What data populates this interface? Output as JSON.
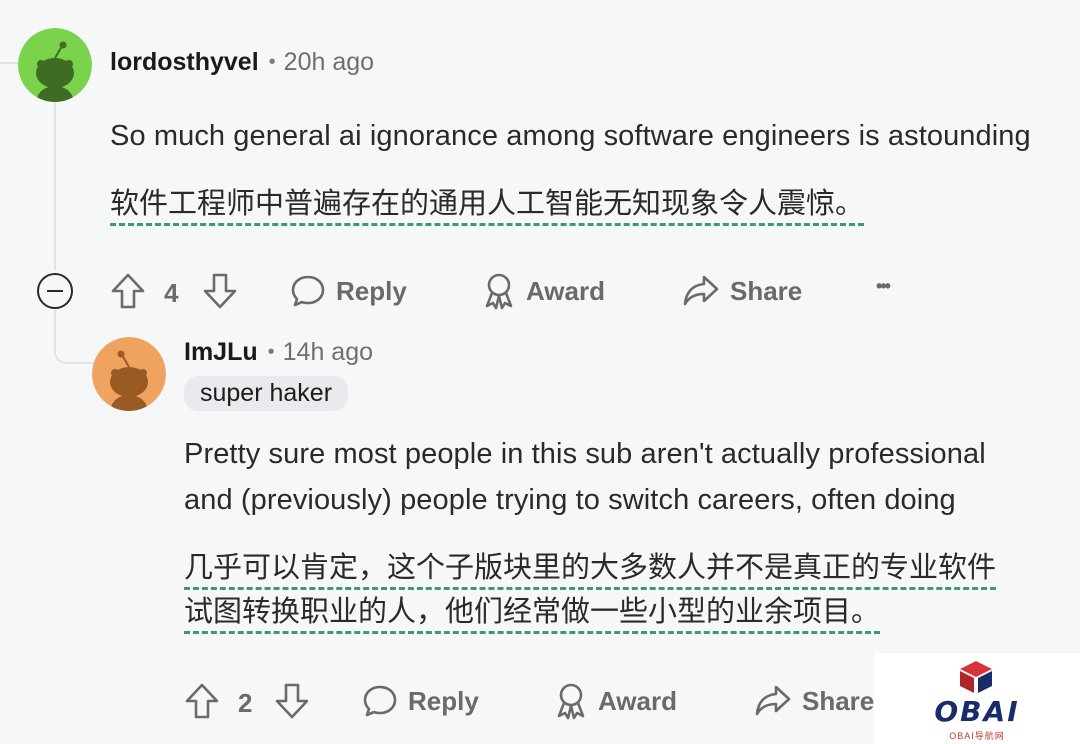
{
  "comment1": {
    "username": "lordosthyvel",
    "separator": "•",
    "time": "20h ago",
    "text_en": "So much general ai ignorance among software engineers is astounding",
    "text_cn": "软件工程师中普遍存在的通用人工智能无知现象令人震惊。",
    "votes": "4",
    "reply_label": "Reply",
    "award_label": "Award",
    "share_label": "Share",
    "more_label": "•••",
    "avatar_color": "#7bd34b"
  },
  "comment2": {
    "username": "ImJLu",
    "separator": "•",
    "time": "14h ago",
    "flair": "super haker",
    "text_en_line1": "Pretty sure most people in this sub aren't actually professional",
    "text_en_line2": "and (previously) people trying to switch careers, often doing",
    "text_cn_line1": "几乎可以肯定，这个子版块里的大多数人并不是真正的专业软件",
    "text_cn_line2": "试图转换职业的人，他们经常做一些小型的业余项目。",
    "votes": "2",
    "reply_label": "Reply",
    "award_label": "Award",
    "share_label": "Share",
    "avatar_color": "#f0a35e"
  },
  "watermark": {
    "brand": "OBAI",
    "subtitle": "OBAI导航网",
    "accent": "#d9343b",
    "brand_color": "#1a2d6b"
  },
  "colors": {
    "background": "#f6f7f8",
    "underline": "#3f9a6f",
    "muted": "#6a6a6a"
  }
}
